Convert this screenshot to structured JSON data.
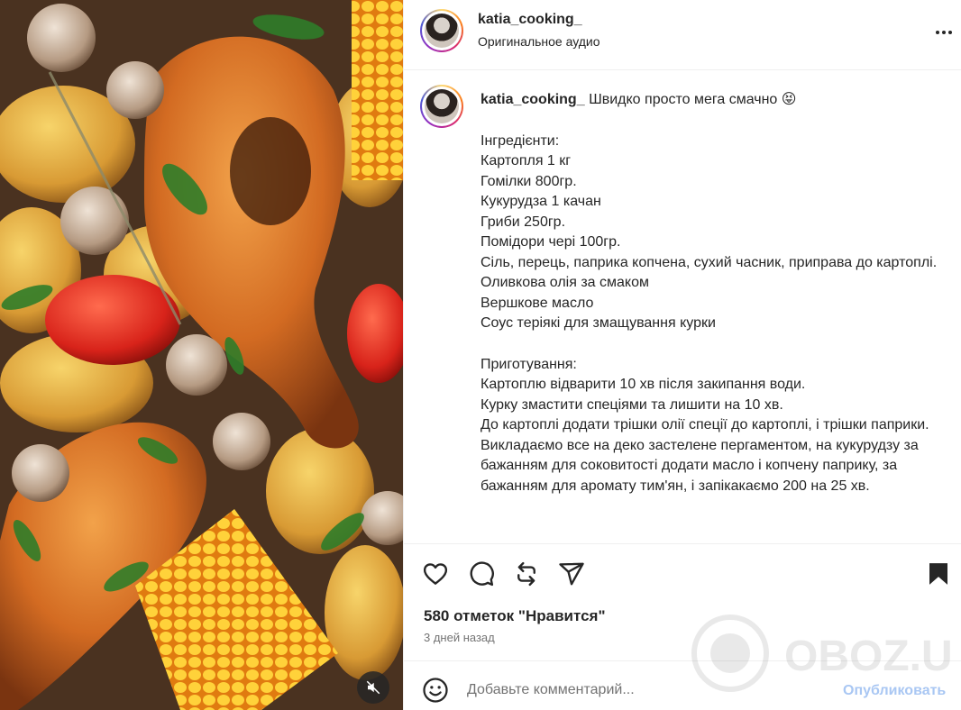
{
  "header": {
    "username": "katia_cooking_",
    "audio_label": "Оригинальное аудио",
    "more_icon": "more-horizontal-icon"
  },
  "caption": {
    "username": "katia_cooking_",
    "headline": "Швидко просто мега смачно",
    "headline_emoji": "😝",
    "ingredients": [
      "Інгредієнти:",
      "Картопля 1 кг",
      "Гомілки 800гр.",
      "Кукурудза 1 качан",
      "Гриби 250гр.",
      "Помідори чері 100гр.",
      "Сіль, перець, паприка копчена, сухий часник, приправа до картоплі.",
      "Оливкова олія за смаком",
      "Вершкове масло",
      "Соус теріякі для змащування курки"
    ],
    "preparation": [
      "Приготування:",
      "Картоплю відварити 10 хв після закипання води.",
      "Курку змастити спеціями та лишити на 10 хв.",
      "До картоплі додати трішки олії спеції до картоплі, і трішки паприки.",
      "Викладаємо все на деко застелене пергаментом, на кукурудзу за бажанням для соковитості додати масло і копчену паприку, за бажанням для аромату тим'ян, і запікакаємо 200 на 25 хв."
    ]
  },
  "actions": {
    "icons": [
      "heart-icon",
      "comment-icon",
      "repost-icon",
      "share-icon",
      "bookmark-icon"
    ],
    "likes_text": "580 отметок \"Нравится\"",
    "time_ago": "3 дней назад"
  },
  "comment": {
    "placeholder": "Добавьте комментарий...",
    "publish_label": "Опубликовать",
    "emoji_icon": "smiley-icon"
  },
  "media": {
    "mute_icon": "speaker-muted-icon"
  },
  "watermark": {
    "text": "OBOZ.UA"
  },
  "colors": {
    "link_blue_disabled": "#a9c7f3",
    "secondary_text": "#737373",
    "divider": "#efefef"
  }
}
